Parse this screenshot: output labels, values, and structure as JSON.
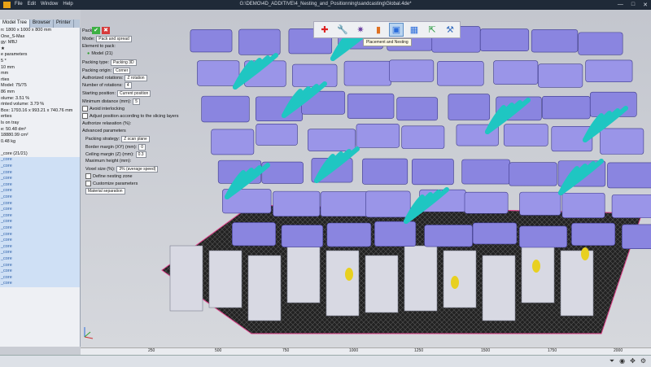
{
  "window": {
    "title": "G:\\DEMO\\4D_ADDITIVE\\4_Nesting_and_Positionning\\sandcasting\\Global.4de*",
    "menu": [
      "File",
      "Edit",
      "Window",
      "Help"
    ],
    "buttons": [
      "—",
      "□",
      "✕"
    ]
  },
  "left_tabs": [
    "Model Tree",
    "Browser",
    "Printer"
  ],
  "left_panel": {
    "rows": [
      "n: 1800 x 1000 x 800 mm",
      "One_S-Max",
      "gy: MBJ",
      "★",
      "e parameters",
      "5 *",
      "10 mm",
      "mm",
      "rties",
      "Model: 75/75",
      "86 mm",
      "olume: 3.51 %",
      "rinted volume: 3.79 %",
      "Box: 1793.16 x 993.21 x 740.76 mm",
      "erties",
      "ls on tray",
      "e: 50.48 dm³",
      "18880.99 cm²",
      "0.48 kg",
      "",
      "_core (21/21)",
      "_core",
      "_core",
      "_core",
      "_core",
      "_core",
      "_core",
      "_core",
      "_core",
      "_core",
      "_core",
      "_core",
      "_core",
      "_core",
      "_core",
      "_core",
      "_core",
      "_core",
      "_core",
      "_core",
      "_core",
      "_core"
    ]
  },
  "pack_panel": {
    "title": "Pack",
    "ok": "✔",
    "cancel": "✖",
    "mode_label": "Mode:",
    "mode_value": "Pack and spread",
    "element_label": "Element to pack:",
    "element_value": "Model (21)",
    "packing_type_label": "Packing type:",
    "packing_type_value": "Packing 3D",
    "packing_origin_label": "Packing origin:",
    "packing_origin_value": "Corner",
    "rotations_label": "Authorized rotations:",
    "rotations_value": "Z rotation",
    "num_rotations_label": "Number of rotations:",
    "num_rotations_value": "4",
    "start_pos_label": "Starting position:",
    "start_pos_value": "Current position",
    "min_dist_label": "Minimum distance (mm):",
    "min_dist_value": "5",
    "avoid_interlocking": "Avoid interlocking",
    "adjust_position": "Adjust position according to the slicing layers",
    "authorize_relaxation": "Authorize relaxation (%):",
    "advanced_label": "Advanced parameters",
    "strategy_label": "Packing strategy:",
    "strategy_value": "Z scan plane",
    "border_label": "Border margin (XY) (mm):",
    "border_value": "0",
    "ceiling_label": "Ceiling margin (Z) (mm):",
    "ceiling_value": "0.3",
    "max_height_label": "Maximum height (mm):",
    "voxel_label": "Voxel size (%):",
    "voxel_value": "3% (average speed)",
    "define_zone": "Define nesting zone",
    "customize": "Customize parameters",
    "material": "Material separation"
  },
  "toolbar": {
    "tooltip": "Placement and Nesting",
    "icons": [
      "first-aid-icon",
      "wrench-icon",
      "sparkle-icon",
      "bar-chart-icon",
      "nesting-icon",
      "grid-icon",
      "export-icon",
      "hammer-icon"
    ]
  },
  "ruler": {
    "ticks": [
      "250",
      "500",
      "750",
      "1000",
      "1250",
      "1500",
      "1750",
      "2000"
    ]
  },
  "colors": {
    "parts": "#8a85e0",
    "manifolds": "#1fc6c2",
    "cores": "#d8d9e3",
    "tray": "#2a2a2a",
    "accent": "#e8d020"
  }
}
